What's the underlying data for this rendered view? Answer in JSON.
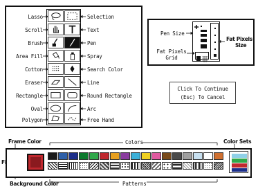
{
  "tools_left": [
    "Lasso",
    "Scroll",
    "Brush",
    "Area Fill",
    "Cotton",
    "Eraser",
    "Rectangle",
    "Oval",
    "Polygon"
  ],
  "tools_right": [
    "Selection",
    "Text",
    "Pen",
    "Spray",
    "Search Color",
    "Line",
    "Round Rectangle",
    "Arc",
    "Free Hand"
  ],
  "pen_panel": {
    "pen_size": "Pen Size",
    "fat_pixels_grid_line1": "Fat Pixels",
    "fat_pixels_grid_line2": "Grid",
    "fat_pixels_size_line1": "Fat Pixels",
    "fat_pixels_size_line2": "Size"
  },
  "continue_box": {
    "line1": "Click To Continue",
    "line2": "(Esc) To Cancel"
  },
  "palette": {
    "frame_color": "Frame Color",
    "colors": "Colors",
    "color_sets": "Color Sets",
    "fill": "Fill",
    "background_color": "Background Color",
    "patterns": "Patterns",
    "color_swatches": [
      "#1a1a1a",
      "#2d5fa8",
      "#1c2f8a",
      "#0d7a2e",
      "#2fa84a",
      "#c0282e",
      "#e8a020",
      "#8a3c9e",
      "#3cb0d8",
      "#f0d020",
      "#e05aa0",
      "#7a4a1a",
      "#4a4a4a",
      "#a0a0a0",
      "#c8e0f0",
      "#ffffff",
      "#d07030"
    ]
  }
}
